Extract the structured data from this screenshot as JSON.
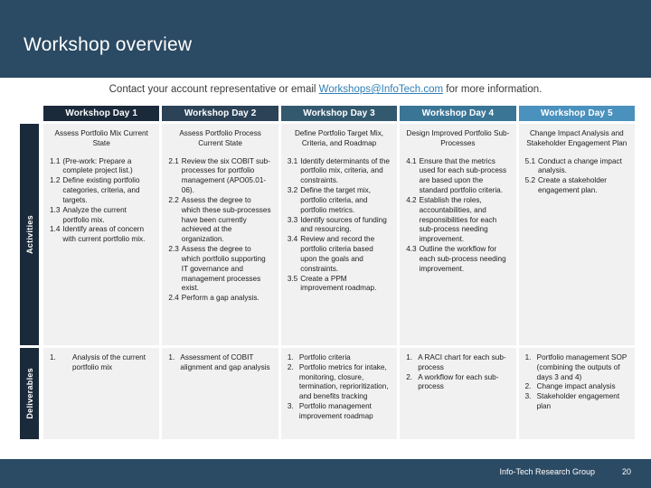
{
  "slide": {
    "title": "Workshop overview",
    "contact": {
      "prefix": "Contact your account representative or email ",
      "email": "Workshops@InfoTech.com",
      "suffix": " for more information."
    }
  },
  "colors": {
    "banner": "#2b4a63",
    "header_day1": "#1b2a3a",
    "header_day2": "#2b4257",
    "header_day3": "#33596f",
    "header_day4": "#3a7596",
    "header_day5": "#4a91bd",
    "cell_bg": "#f1f1f1",
    "link": "#2f7fb5"
  },
  "row_labels": {
    "activities": "Activities",
    "deliverables": "Deliverables"
  },
  "columns": [
    {
      "header": "Workshop Day 1",
      "activity_title": "Assess Portfolio Mix Current State",
      "activities": [
        {
          "num": "1.1",
          "text": "(Pre-work: Prepare a complete project list.)"
        },
        {
          "num": "1.2",
          "text": "Define existing portfolio categories, criteria, and targets."
        },
        {
          "num": "1.3",
          "text": "Analyze the current portfolio mix."
        },
        {
          "num": "1.4",
          "text": "Identify areas of concern with current portfolio mix."
        }
      ],
      "deliverables": [
        {
          "num": "1.",
          "text": "Analysis of the current portfolio mix"
        }
      ]
    },
    {
      "header": "Workshop Day 2",
      "activity_title": "Assess Portfolio Process Current State",
      "activities": [
        {
          "num": "2.1",
          "text": "Review the six COBIT sub-processes for portfolio management (APO05.01-06)."
        },
        {
          "num": "2.2",
          "text": "Assess the degree to which these sub-processes have been currently achieved at the organization."
        },
        {
          "num": "2.3",
          "text": "Assess the degree to which portfolio supporting IT governance and management processes exist."
        },
        {
          "num": "2.4",
          "text": "Perform a gap analysis."
        }
      ],
      "deliverables": [
        {
          "num": "1.",
          "text": "Assessment of COBIT alignment and gap analysis"
        }
      ]
    },
    {
      "header": "Workshop Day 3",
      "activity_title": "Define Portfolio Target Mix, Criteria, and Roadmap",
      "activities": [
        {
          "num": "3.1",
          "text": "Identify determinants of the portfolio mix, criteria, and constraints."
        },
        {
          "num": "3.2",
          "text": "Define the target mix, portfolio criteria, and portfolio metrics."
        },
        {
          "num": "3.3",
          "text": "Identify sources of funding and resourcing."
        },
        {
          "num": "3.4",
          "text": "Review and record the portfolio criteria based upon the goals and constraints."
        },
        {
          "num": "3.5",
          "text": "Create a PPM improvement roadmap."
        }
      ],
      "deliverables": [
        {
          "num": "1.",
          "text": "Portfolio criteria"
        },
        {
          "num": "2.",
          "text": "Portfolio metrics for intake, monitoring, closure, termination, reprioritization, and benefits tracking"
        },
        {
          "num": "3.",
          "text": "Portfolio management improvement roadmap"
        }
      ]
    },
    {
      "header": "Workshop Day 4",
      "activity_title": "Design Improved Portfolio Sub-Processes",
      "activities": [
        {
          "num": "4.1",
          "text": "Ensure that the metrics used for each sub-process are based upon the standard portfolio criteria."
        },
        {
          "num": "4.2",
          "text": "Establish the roles, accountabilities, and responsibilities for each sub-process needing improvement."
        },
        {
          "num": "4.3",
          "text": "Outline the workflow for each sub-process needing improvement."
        }
      ],
      "deliverables": [
        {
          "num": "1.",
          "text": "A RACI chart for each sub-process"
        },
        {
          "num": "2.",
          "text": "A workflow for each sub-process"
        }
      ]
    },
    {
      "header": "Workshop Day 5",
      "activity_title": "Change Impact Analysis and Stakeholder Engagement Plan",
      "activities": [
        {
          "num": "5.1",
          "text": "Conduct a change impact analysis."
        },
        {
          "num": "5.2",
          "text": "Create a stakeholder engagement plan."
        }
      ],
      "deliverables": [
        {
          "num": "1.",
          "text": "Portfolio management SOP (combining the outputs of days 3 and 4)"
        },
        {
          "num": "2.",
          "text": "Change impact analysis"
        },
        {
          "num": "3.",
          "text": "Stakeholder engagement plan"
        }
      ]
    }
  ],
  "footer": {
    "brand": "Info-Tech Research Group",
    "page": "20"
  }
}
